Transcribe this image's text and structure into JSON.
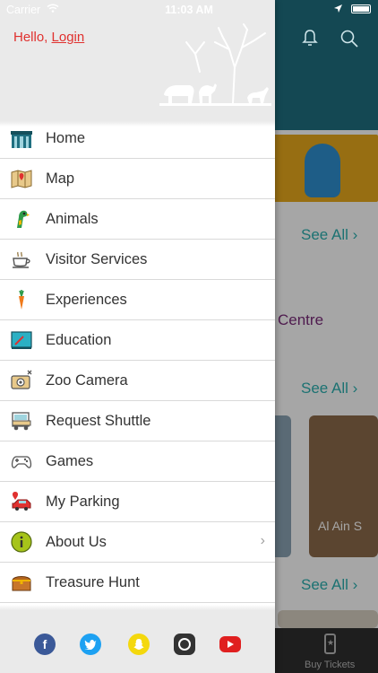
{
  "status_bar": {
    "carrier": "Carrier",
    "time": "11:03 AM"
  },
  "background": {
    "see_all_1": "See All ›",
    "see_all_2": "See All ›",
    "see_all_3": "See All ›",
    "centre_text": "Centre",
    "card_label": "Al Ain S",
    "tab_buy_tickets": "Buy Tickets",
    "accent_color": "#1f6f80"
  },
  "drawer": {
    "greeting_prefix": "Hello, ",
    "login_label": "Login",
    "items": [
      {
        "label": "Home",
        "icon": "zoo-gate-icon"
      },
      {
        "label": "Map",
        "icon": "map-icon"
      },
      {
        "label": "Animals",
        "icon": "parrot-icon"
      },
      {
        "label": "Visitor Services",
        "icon": "coffee-cup-icon"
      },
      {
        "label": "Experiences",
        "icon": "carrot-icon"
      },
      {
        "label": "Education",
        "icon": "blackboard-icon"
      },
      {
        "label": "Zoo Camera",
        "icon": "camera-icon"
      },
      {
        "label": "Request Shuttle",
        "icon": "shuttle-icon"
      },
      {
        "label": "Games",
        "icon": "gamepad-icon"
      },
      {
        "label": "My Parking",
        "icon": "car-pin-icon"
      },
      {
        "label": "About Us",
        "icon": "info-icon"
      },
      {
        "label": "Treasure Hunt",
        "icon": "treasure-chest-icon"
      }
    ],
    "about_chevron": "›",
    "social": [
      "facebook-icon",
      "twitter-icon",
      "snapchat-icon",
      "instagram-icon",
      "youtube-icon"
    ]
  }
}
